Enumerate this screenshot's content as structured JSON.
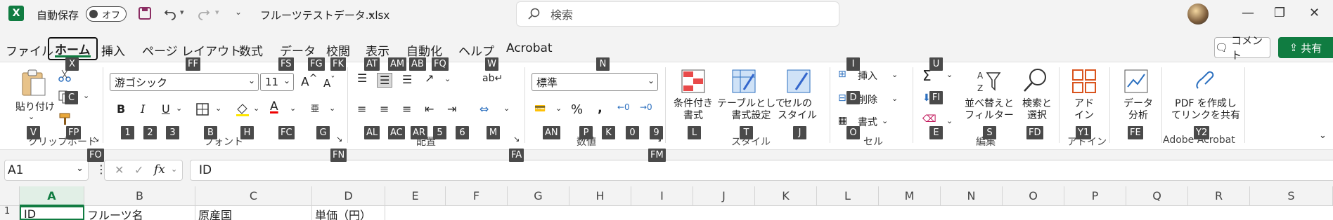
{
  "titlebar": {
    "app_icon": "X",
    "autosave_label": "自動保存",
    "autosave_state": "オフ",
    "filename": "フルーツテストデータ.xlsx",
    "search_placeholder": "検索"
  },
  "menu": {
    "tabs": [
      "ファイル",
      "ホーム",
      "挿入",
      "ページ レイアウト",
      "数式",
      "データ",
      "校閲",
      "表示",
      "自動化",
      "ヘルプ",
      "Acrobat"
    ],
    "active_tab": "ホーム",
    "comment_button": "コメント",
    "share_button": "共有"
  },
  "ribbon": {
    "paste_label": "貼り付け",
    "clipboard_group": "クリップボード",
    "font_name": "游ゴシック",
    "font_size": "11",
    "font_group": "フォント",
    "align_group": "配置",
    "number_format": "標準",
    "number_group": "数値",
    "cond_format": "条件付き\n書式",
    "table_format": "テーブルとして\n書式設定",
    "cell_style": "セルの\nスタイル",
    "style_group": "スタイル",
    "insert_label": "挿入",
    "delete_label": "削除",
    "format_label": "書式",
    "cell_group": "セル",
    "sort_filter": "並べ替えと\nフィルター",
    "find_select": "検索と\n選択",
    "edit_group": "編集",
    "addin_label": "アド\nイン",
    "addin_group": "アドイン",
    "analyze_label": "データ\n分析",
    "pdf_label": "PDF を作成し\nてリンクを共有",
    "acrobat_group": "Adobe Acrobat"
  },
  "keytips": [
    "X",
    "FF",
    "FS",
    "FG",
    "FK",
    "AT",
    "AM",
    "AB",
    "FQ",
    "W",
    "N",
    "I",
    "U",
    "C",
    "V",
    "FP",
    "1",
    "2",
    "3",
    "B",
    "H",
    "FC",
    "G",
    "AL",
    "AC",
    "AR",
    "5",
    "6",
    "M",
    "AN",
    "P",
    "K",
    "0",
    "9",
    "L",
    "T",
    "J",
    "D",
    "O",
    "FI",
    "E",
    "S",
    "FD",
    "Y1",
    "FE",
    "Y2",
    "FO",
    "FN",
    "FA",
    "FM"
  ],
  "formula_bar": {
    "name_box": "A1",
    "formula": "ID"
  },
  "sheet": {
    "columns": [
      "A",
      "B",
      "C",
      "D",
      "E",
      "F",
      "G",
      "H",
      "I",
      "J",
      "K",
      "L",
      "M",
      "N",
      "O",
      "P",
      "Q",
      "R",
      "S"
    ],
    "row1": [
      "ID",
      "フルーツ名",
      "原産国",
      "単価（円）"
    ],
    "row_number": "1"
  }
}
